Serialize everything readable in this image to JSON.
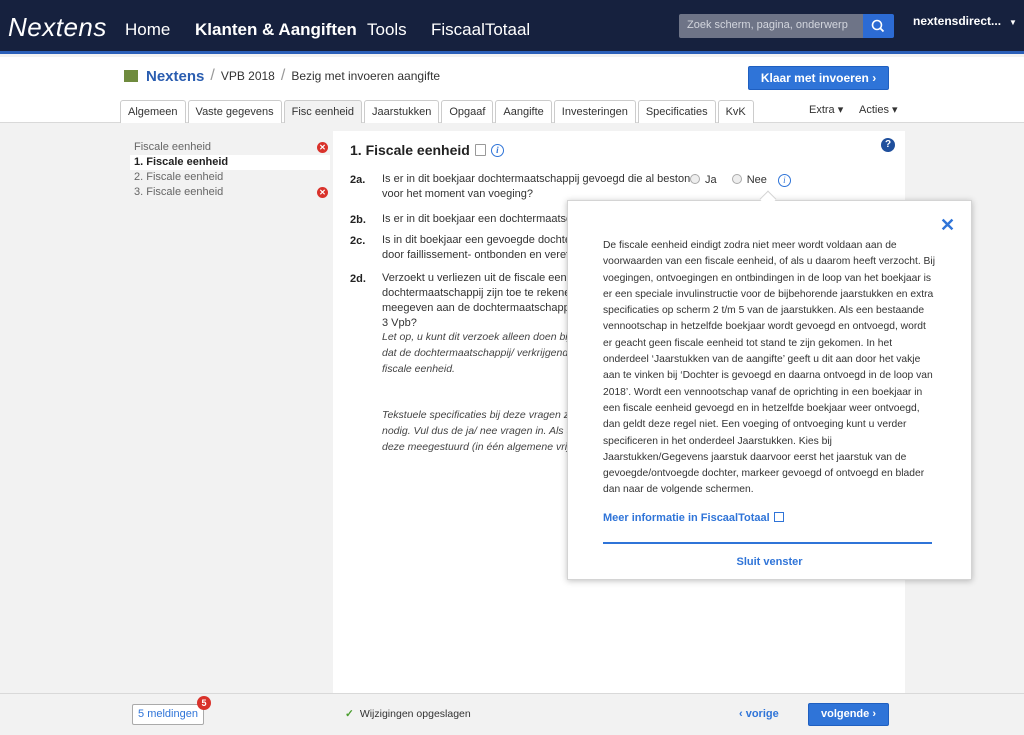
{
  "nav": {
    "brand": "Nextens",
    "items": [
      "Home",
      "Klanten & Aangiften",
      "Tools",
      "FiscaalTotaal"
    ],
    "search_placeholder": "Zoek scherm, pagina, onderwerp",
    "user": "nextensdirect..."
  },
  "breadcrumb": {
    "home": "Nextens",
    "level1": "VPB 2018",
    "level2": "Bezig met invoeren aangifte"
  },
  "header": {
    "done_button": "Klaar met invoeren  ›",
    "extra": "Extra ▾",
    "acties": "Acties ▾"
  },
  "tabs": [
    "Algemeen",
    "Vaste gegevens",
    "Fisc eenheid",
    "Jaarstukken",
    "Opgaaf",
    "Aangifte",
    "Investeringen",
    "Specificaties",
    "KvK"
  ],
  "sidebar": {
    "items": [
      {
        "label": "Fiscale eenheid"
      },
      {
        "label": "1. Fiscale eenheid"
      },
      {
        "label": "2. Fiscale eenheid"
      },
      {
        "label": "3. Fiscale eenheid"
      }
    ]
  },
  "main": {
    "title": "1. Fiscale eenheid",
    "q2a": {
      "num": "2a.",
      "line1": "Is er in dit boekjaar dochtermaatschappij gevoegd die al bestond",
      "line2": "voor het moment van voeging?"
    },
    "radio_ja": "Ja",
    "radio_nee": "Nee",
    "q2b": {
      "num": "2b.",
      "text": "Is er in dit boekjaar een dochtermaatschapp"
    },
    "q2c": {
      "num": "2c.",
      "line1": "Is in dit boekjaar een gevoegde dochtermaat",
      "line2": "door faillissement- ontbonden en vereffend"
    },
    "q2d": {
      "num": "2d.",
      "line1": "Verzoekt u verliezen uit de fiscale eenheid o",
      "line2": "dochtermaatschappij zijn toe te rekenen, na",
      "line3": "meegeven aan de dochtermaatschappij, in",
      "line4": "3 Vpb?"
    },
    "note1": {
      "line1": "Let op, u kunt dit verzoek alleen doen bij de",
      "line2": "dat de dochtermaatschappij/ verkrijgende re",
      "line3": "fiscale eenheid."
    },
    "note2": {
      "line1": "Tekstuele specificaties bij deze vragen zijn",
      "line2": "nodig. Vul dus de ja/ nee vragen in. Als u d",
      "line3": "deze meegestuurd (in één algemene vrije s"
    }
  },
  "popover": {
    "body": "De fiscale eenheid eindigt zodra niet meer wordt voldaan aan de voorwaarden van een fiscale eenheid, of als u daarom heeft verzocht. Bij voegingen, ontvoegingen en ontbindingen in de loop van het boekjaar is er een speciale invulinstructie voor de bijbehorende jaarstukken en extra specificaties op scherm 2 t/m 5 van de jaarstukken.  Als een bestaande vennootschap in hetzelfde boekjaar wordt gevoegd en ontvoegd, wordt er geacht geen fiscale eenheid tot stand te zijn gekomen. In het onderdeel ‘Jaarstukken van de aangifte’ geeft u dit aan door het vakje aan te vinken bij ‘Dochter is gevoegd en daarna ontvoegd in de loop van 2018’. Wordt een vennootschap vanaf de oprichting in een boekjaar in een fiscale eenheid gevoegd en in hetzelfde boekjaar weer ontvoegd, dan geldt deze regel niet.  Een voeging of ontvoeging kunt u verder specificeren in het onderdeel Jaarstukken. Kies bij Jaarstukken/Gegevens jaarstuk daarvoor eerst het jaarstuk van de gevoegde/ontvoegde dochter, markeer gevoegd of ontvoegd en blader dan naar de volgende schermen.",
    "link": "Meer informatie in FiscaalTotaal",
    "close": "Sluit venster"
  },
  "footer": {
    "meldingen": "5 meldingen",
    "badge": "5",
    "saved": "Wijzigingen opgeslagen",
    "prev": "‹  vorige",
    "next": "volgende  ›"
  }
}
